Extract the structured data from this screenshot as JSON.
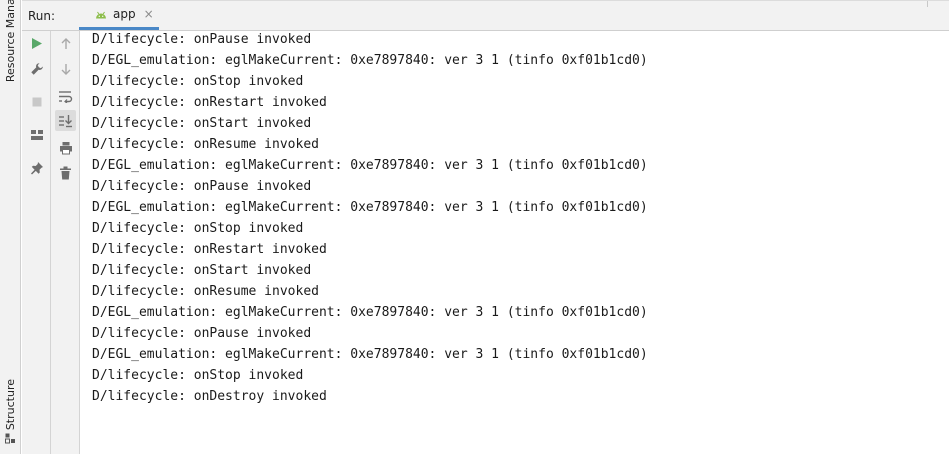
{
  "side_panel": {
    "top_tab": "Resource Manager",
    "bottom_tab": "Structure"
  },
  "header": {
    "run_label": "Run:",
    "tab": {
      "label": "app",
      "close": "×"
    }
  },
  "toolbar_primary": [
    {
      "icon": "play-icon"
    },
    {
      "icon": "wrench-icon"
    },
    {
      "icon": "stop-icon"
    },
    {
      "icon": "layout-icon"
    },
    {
      "icon": "pin-icon"
    }
  ],
  "toolbar_secondary": [
    {
      "icon": "arrow-up-icon"
    },
    {
      "icon": "arrow-down-icon"
    },
    {
      "icon": "soft-wrap-icon"
    },
    {
      "icon": "scroll-to-end-icon",
      "active": true
    },
    {
      "icon": "print-icon"
    },
    {
      "icon": "trash-icon"
    }
  ],
  "colors": {
    "accent": "#4a88c7",
    "play": "#59a869",
    "icon": "#6e6e6e"
  },
  "console_lines": [
    "D/lifecycle: onPause invoked",
    "D/EGL_emulation: eglMakeCurrent: 0xe7897840: ver 3 1 (tinfo 0xf01b1cd0)",
    "D/lifecycle: onStop invoked",
    "D/lifecycle: onRestart invoked",
    "D/lifecycle: onStart invoked",
    "D/lifecycle: onResume invoked",
    "D/EGL_emulation: eglMakeCurrent: 0xe7897840: ver 3 1 (tinfo 0xf01b1cd0)",
    "D/lifecycle: onPause invoked",
    "D/EGL_emulation: eglMakeCurrent: 0xe7897840: ver 3 1 (tinfo 0xf01b1cd0)",
    "D/lifecycle: onStop invoked",
    "D/lifecycle: onRestart invoked",
    "D/lifecycle: onStart invoked",
    "D/lifecycle: onResume invoked",
    "D/EGL_emulation: eglMakeCurrent: 0xe7897840: ver 3 1 (tinfo 0xf01b1cd0)",
    "D/lifecycle: onPause invoked",
    "D/EGL_emulation: eglMakeCurrent: 0xe7897840: ver 3 1 (tinfo 0xf01b1cd0)",
    "D/lifecycle: onStop invoked",
    "D/lifecycle: onDestroy invoked"
  ]
}
